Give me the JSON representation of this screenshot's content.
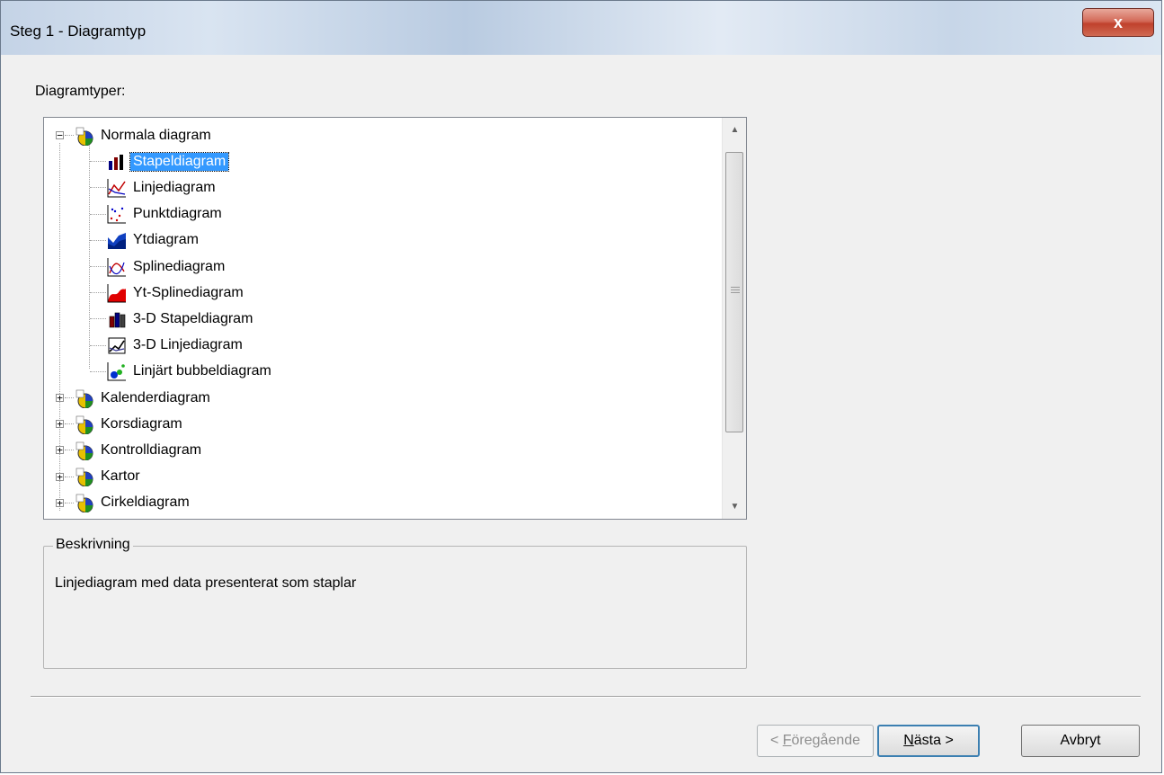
{
  "window": {
    "title": "Steg 1 - Diagramtyp",
    "close_label": "x"
  },
  "tree_label": "Diagramtyper:",
  "tree": {
    "groups": [
      {
        "label": "Normala diagram",
        "expanded": true,
        "expander": "−",
        "children": [
          {
            "label": "Stapeldiagram",
            "icon": "bar-chart-icon",
            "selected": true
          },
          {
            "label": "Linjediagram",
            "icon": "line-chart-icon"
          },
          {
            "label": "Punktdiagram",
            "icon": "scatter-chart-icon"
          },
          {
            "label": "Ytdiagram",
            "icon": "area-chart-icon"
          },
          {
            "label": "Splinediagram",
            "icon": "spline-chart-icon"
          },
          {
            "label": "Yt-Splinediagram",
            "icon": "area-spline-chart-icon"
          },
          {
            "label": "3-D Stapeldiagram",
            "icon": "3d-bar-chart-icon"
          },
          {
            "label": "3-D Linjediagram",
            "icon": "3d-line-chart-icon"
          },
          {
            "label": "Linjärt bubbeldiagram",
            "icon": "bubble-chart-icon"
          }
        ]
      },
      {
        "label": "Kalenderdiagram",
        "expanded": false,
        "expander": "+"
      },
      {
        "label": "Korsdiagram",
        "expanded": false,
        "expander": "+"
      },
      {
        "label": "Kontrolldiagram",
        "expanded": false,
        "expander": "+"
      },
      {
        "label": "Kartor",
        "expanded": false,
        "expander": "+"
      },
      {
        "label": "Cirkeldiagram",
        "expanded": false,
        "expander": "+"
      }
    ]
  },
  "description": {
    "title": "Beskrivning",
    "text": "Linjediagram med data presenterat som staplar"
  },
  "buttons": {
    "back_prefix": "< ",
    "back_accel": "F",
    "back_rest": "öregående",
    "next_accel": "N",
    "next_rest": "ästa >",
    "cancel": "Avbryt"
  },
  "colors": {
    "selection": "#3399ff",
    "titlebar": "#c8d7ea",
    "close": "#c8452f"
  }
}
